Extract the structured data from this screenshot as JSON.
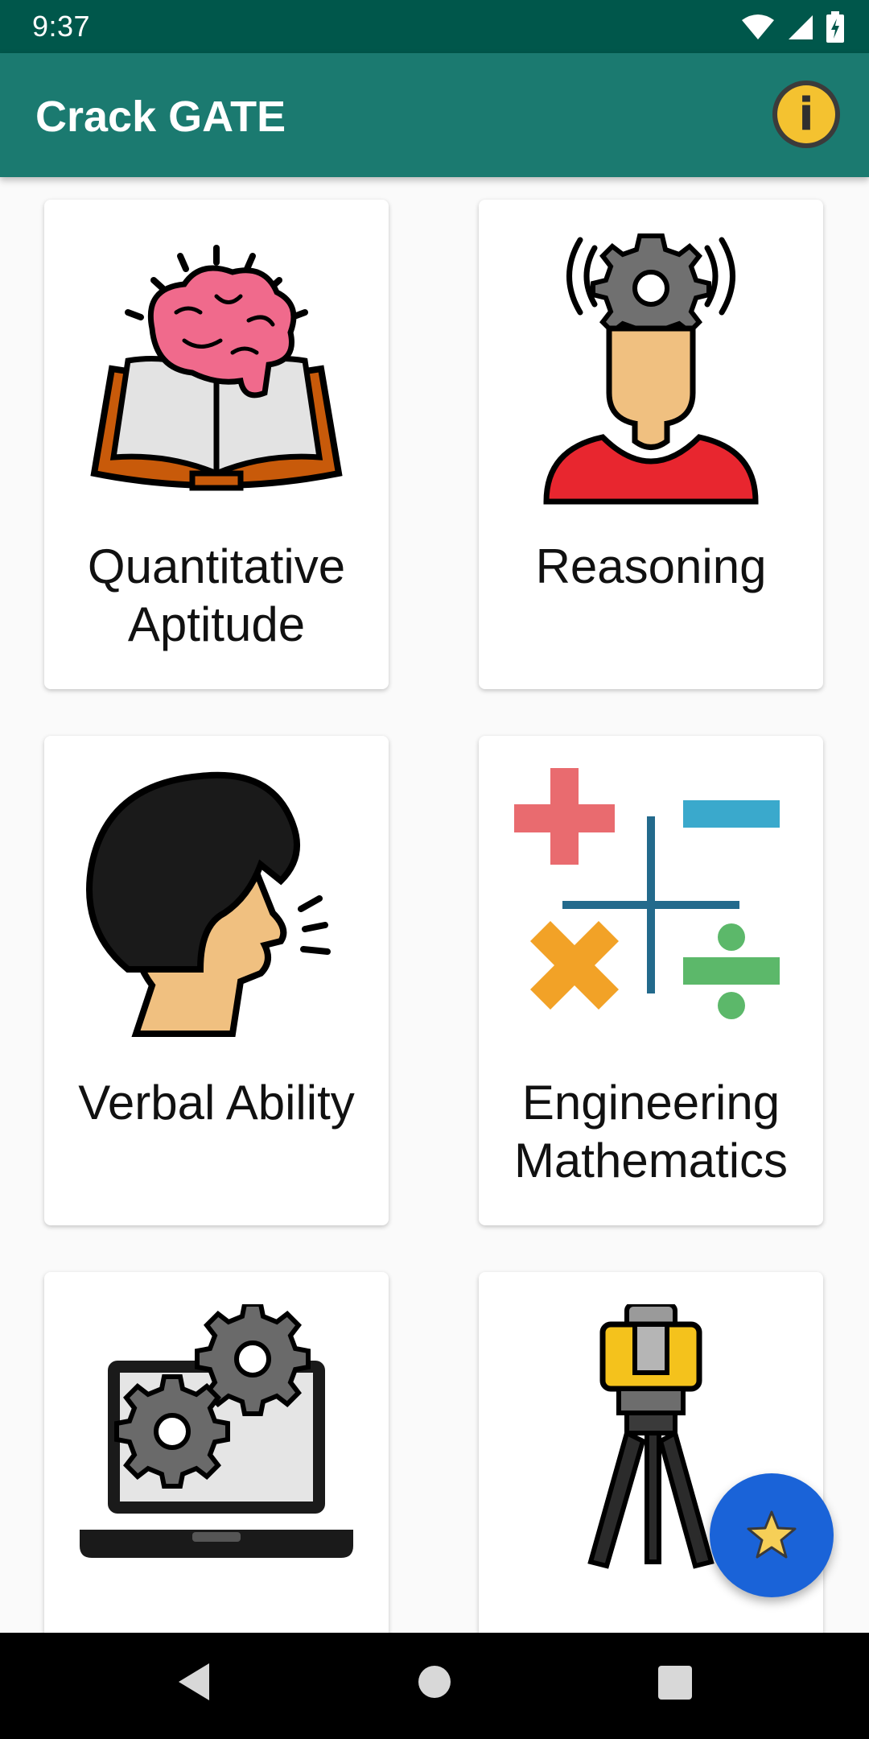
{
  "status_bar": {
    "time": "9:37",
    "icons": [
      "wifi-icon",
      "cellular-icon",
      "battery-icon"
    ]
  },
  "app_bar": {
    "title": "Crack GATE",
    "info_icon": "info-icon",
    "info_glyph": "i"
  },
  "categories": [
    {
      "label": "Quantitative Aptitude",
      "icon": "brain-book-icon"
    },
    {
      "label": "Reasoning",
      "icon": "person-gear-icon"
    },
    {
      "label": "Verbal Ability",
      "icon": "speaking-head-icon"
    },
    {
      "label": "Engineering Mathematics",
      "icon": "math-operators-icon"
    },
    {
      "label": "",
      "icon": "laptop-gears-icon"
    },
    {
      "label": "",
      "icon": "surveying-tripod-icon"
    }
  ],
  "fab": {
    "icon": "star-icon"
  },
  "nav_bar": {
    "buttons": [
      "back-icon",
      "home-icon",
      "recents-icon"
    ]
  },
  "colors": {
    "status_bar": "#00574b",
    "app_bar": "#1b7a70",
    "fab": "#1a63d8",
    "info_button": "#f4c230"
  }
}
